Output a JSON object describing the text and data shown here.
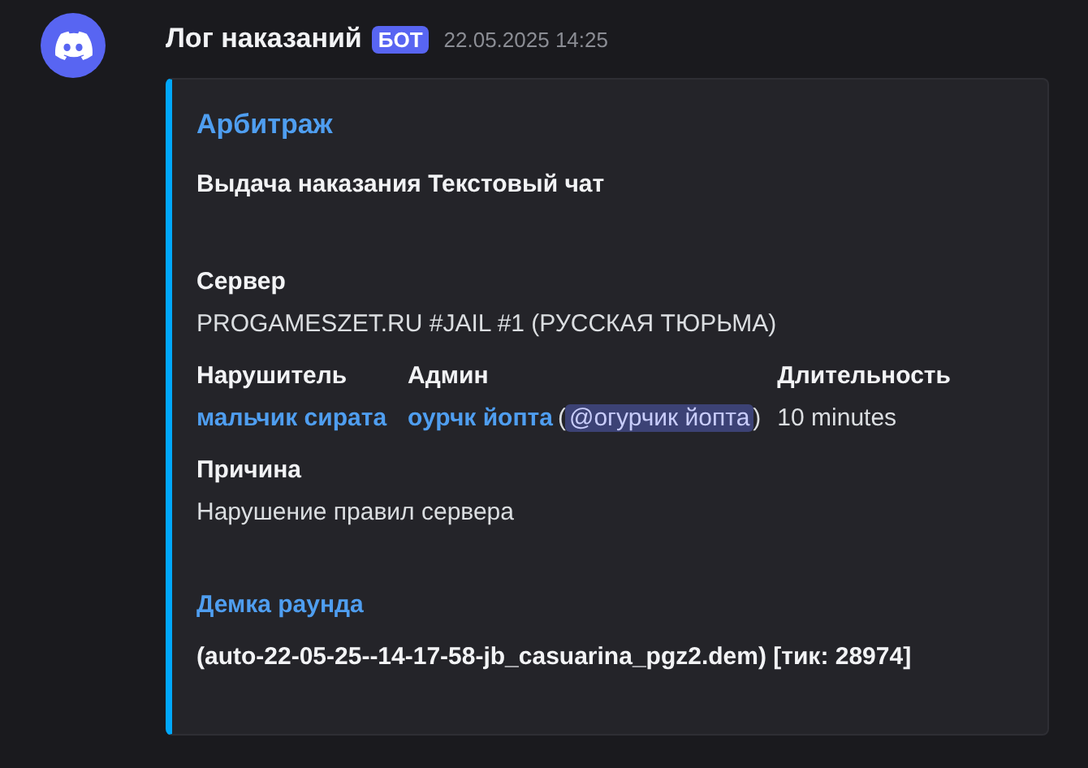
{
  "message": {
    "author": "Лог наказаний",
    "badge": "БОТ",
    "timestamp": "22.05.2025 14:25"
  },
  "embed": {
    "color": "#00a8fc",
    "title": "Арбитраж",
    "description": "Выдача наказания Текстовый чат",
    "field_rows": [
      [
        {
          "name": "Сервер",
          "value": [
            {
              "kind": "text",
              "text": "PROGAMESZET.RU #JAIL #1 (РУССКАЯ ТЮРЬМА)"
            }
          ]
        }
      ],
      [
        {
          "name": "Нарушитель",
          "value": [
            {
              "kind": "link",
              "text": "мальчик сирата"
            }
          ]
        },
        {
          "name": "Админ",
          "value": [
            {
              "kind": "link",
              "text": "оурчк йопта"
            },
            {
              "kind": "text",
              "text": "("
            },
            {
              "kind": "mention",
              "text": "@огурчик йопта"
            },
            {
              "kind": "text",
              "text": ")"
            }
          ]
        },
        {
          "name": "Длительность",
          "value": [
            {
              "kind": "text",
              "text": "10 minutes"
            }
          ]
        }
      ],
      [
        {
          "name": "Причина",
          "value": [
            {
              "kind": "text",
              "text": "Нарушение правил сервера"
            }
          ]
        }
      ]
    ],
    "link_title": "Демка раунда",
    "demo": "(auto-22-05-25--14-17-58-jb_casuarina_pgz2.dem) [тик: 28974]"
  }
}
